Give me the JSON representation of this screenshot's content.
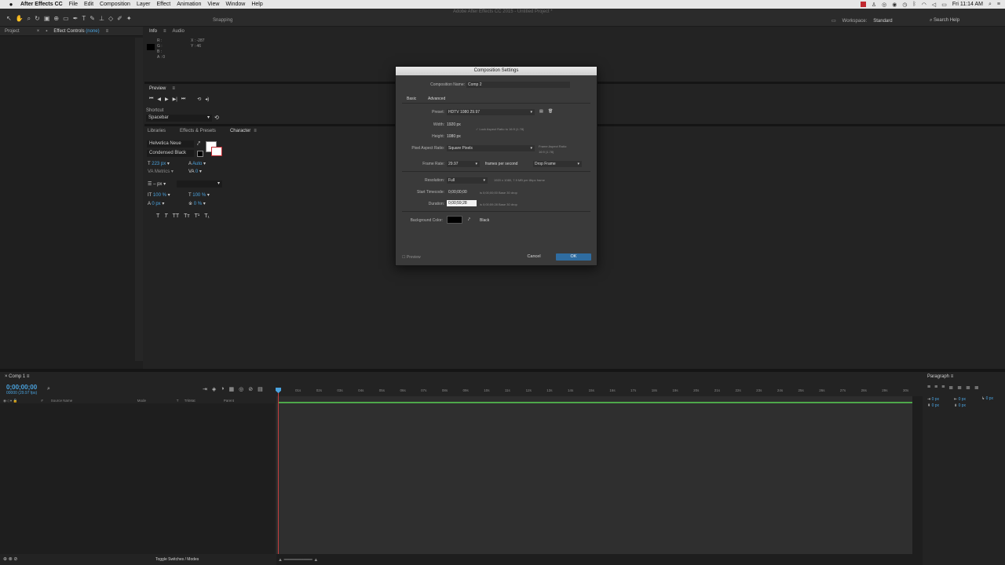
{
  "menubar": {
    "app": "After Effects CC",
    "items": [
      "File",
      "Edit",
      "Composition",
      "Layer",
      "Effect",
      "Animation",
      "View",
      "Window",
      "Help"
    ],
    "clock": "Fri 11:14 AM"
  },
  "toolbar": {
    "window_title": "Adobe After Effects CC 2015 - Untitled Project *",
    "snapping": "Snapping",
    "workspace_label": "Workspace:",
    "workspace_value": "Standard",
    "search": "Search Help"
  },
  "project_panel": {
    "tab_project": "Project",
    "tab_effects": "Effect Controls",
    "tab_effects_target": "(none)"
  },
  "info_panel": {
    "tab_info": "Info",
    "tab_audio": "Audio",
    "r": "R :",
    "g": "G :",
    "b": "B :",
    "a": "A : 0",
    "x": "X : -287",
    "y": "Y : 46"
  },
  "preview_panel": {
    "title": "Preview",
    "shortcut_label": "Shortcut",
    "shortcut_value": "Spacebar"
  },
  "character_panel": {
    "tabs": [
      "Libraries",
      "Effects & Presets",
      "Character"
    ],
    "font": "Helvetica Neue",
    "style": "Condensed Black",
    "size": "223 px",
    "leading": "Auto",
    "kerning": "Metrics",
    "tracking": "0",
    "stroke": "– px",
    "vscale": "100 %",
    "hscale": "100 %",
    "baseline": "0 px",
    "tsume": "0 %"
  },
  "timeline": {
    "tab": "Comp 1",
    "timecode": "0;00;00;00",
    "fps": "00000 (29.97 fps)",
    "col_source": "Source Name",
    "col_mode": "Mode",
    "col_t": "T",
    "col_trkmat": "TrkMat",
    "col_parent": "Parent",
    "toggle": "Toggle Switches / Modes",
    "ticks": [
      "01s",
      "02s",
      "03s",
      "04s",
      "05s",
      "06s",
      "07s",
      "08s",
      "09s",
      "10s",
      "11s",
      "12s",
      "13s",
      "14s",
      "15s",
      "16s",
      "17s",
      "18s",
      "19s",
      "20s",
      "21s",
      "22s",
      "23s",
      "24s",
      "25s",
      "26s",
      "27s",
      "28s",
      "29s",
      "30s"
    ]
  },
  "paragraph_panel": {
    "title": "Paragraph",
    "v1": "0 px",
    "v2": "0 px",
    "v3": "0 px",
    "v4": "0 px",
    "v5": "0 px"
  },
  "dialog": {
    "title": "Composition Settings",
    "name_label": "Composition Name:",
    "name_value": "Comp 2",
    "tab_basic": "Basic",
    "tab_advanced": "Advanced",
    "preset_label": "Preset:",
    "preset_value": "HDTV 1080 29.97",
    "width_label": "Width:",
    "width_value": "1920 px",
    "height_label": "Height:",
    "height_value": "1080 px",
    "lock_label": "Lock Aspect Ratio to 16:9 (1.78)",
    "par_label": "Pixel Aspect Ratio:",
    "par_value": "Square Pixels",
    "frame_aspect_label": "Frame Aspect Ratio:",
    "frame_aspect_value": "16:9 (1.78)",
    "fr_label": "Frame Rate:",
    "fr_value": "29.97",
    "fr_unit": "frames per second",
    "fr_mode": "Drop Frame",
    "res_label": "Resolution:",
    "res_value": "Full",
    "res_info": "1920 x 1080, 7.9 MB per 8bpc frame",
    "start_label": "Start Timecode:",
    "start_value": "0;00;00;00",
    "start_info": "is 0;00;00;00  Base 30  drop",
    "dur_label": "Duration:",
    "dur_value": "0;00;59;28",
    "dur_info": "is 0;00;59;28  Base 30  drop",
    "bg_label": "Background Color:",
    "bg_value": "Black",
    "preview_label": "Preview",
    "cancel": "Cancel",
    "ok": "OK"
  },
  "colors": {
    "accent": "#4aa3df",
    "ok_button": "#2f6ca0",
    "playhead": "#c23c3c",
    "work_area": "#4ea84a"
  }
}
